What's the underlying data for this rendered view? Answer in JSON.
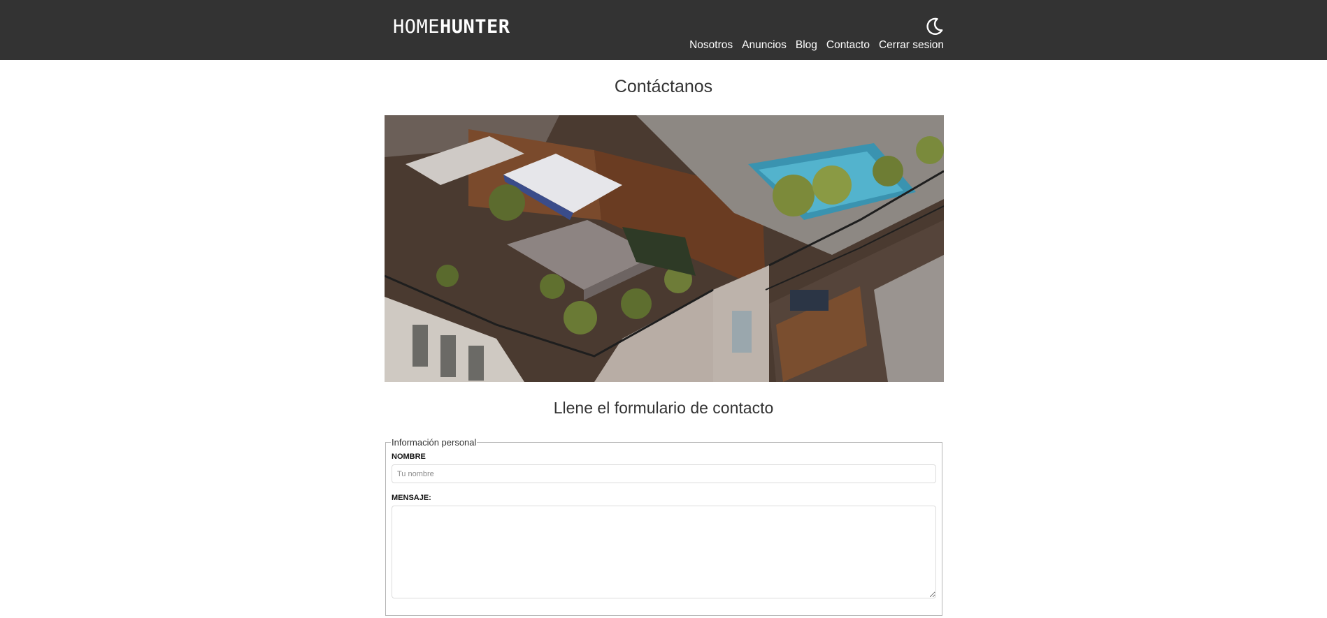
{
  "brand": {
    "light": "HOME",
    "bold": "HUNTER"
  },
  "theme_toggle": {
    "icon": "moon-icon"
  },
  "nav": {
    "items": [
      "Nosotros",
      "Anuncios",
      "Blog",
      "Contacto",
      "Cerrar sesion"
    ]
  },
  "page": {
    "title": "Contáctanos",
    "form_title": "Llene el formulario de contacto"
  },
  "form": {
    "legend": "Información personal",
    "name_label": "NOMBRE",
    "name_placeholder": "Tu nombre",
    "name_value": "",
    "message_label": "MENSAJE:",
    "message_value": ""
  },
  "colors": {
    "header_bg": "#333333",
    "text": "#333333",
    "nav_text": "#ffffff"
  }
}
